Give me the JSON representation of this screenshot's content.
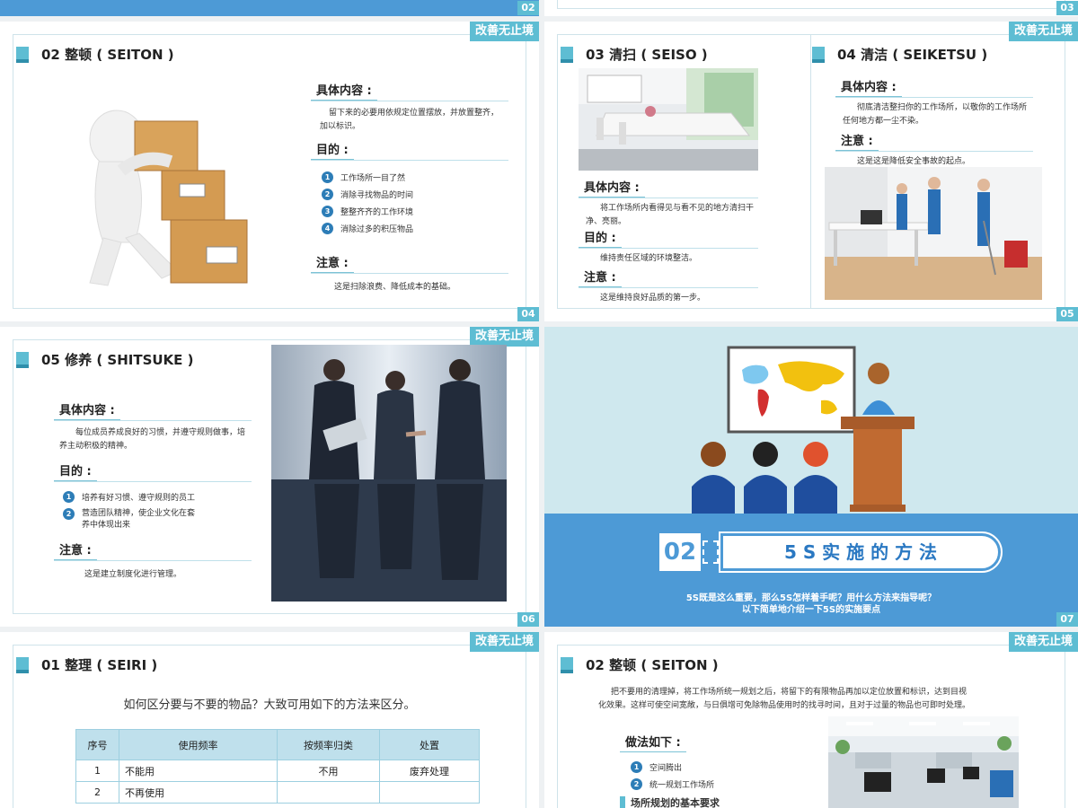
{
  "slides": {
    "s2_top": {
      "page": "02"
    },
    "s3_top": {
      "page": "03"
    },
    "s4": {
      "tag": "改善无止境",
      "page": "04",
      "title": "02  整顿 ( SEITON )",
      "content_header": "具体内容 :",
      "content_text": "留下来的必要用依规定位置摆放，并放置整齐，加以标识。",
      "purpose_header": "目的 :",
      "items": [
        "工作场所一目了然",
        "消除寻找物品的时间",
        "整整齐齐的工作环境",
        "消除过多的积压物品"
      ],
      "note_header": "注意 :",
      "note_text": "这是扫除浪费、降低成本的基础。"
    },
    "s5": {
      "tag": "改善无止境",
      "page": "05",
      "left_title": "03  清扫 ( SEISO )",
      "left_content_header": "具体内容 :",
      "left_content_text": "将工作场所内看得见与看不见的地方清扫干净、亮丽。",
      "left_purpose_header": "目的 :",
      "left_purpose_text": "维持责任区域的环境整洁。",
      "left_note_header": "注意 :",
      "left_note_text": "这是维持良好品质的第一步。",
      "right_title": "04  清洁 ( SEIKETSU )",
      "right_content_header": "具体内容 :",
      "right_content_text": "彻底清洁整扫你的工作场所，以敬你的工作场所任何地方都一尘不染。",
      "right_note_header": "注意 :",
      "right_note_text": "这是这是降低安全事故的起点。"
    },
    "s6": {
      "tag": "改善无止境",
      "page": "06",
      "title": "05  修养 ( SHITSUKE )",
      "content_header": "具体内容 :",
      "content_text": "每位成员养成良好的习惯，并遵守规则做事，培养主动积极的精神。",
      "purpose_header": "目的 :",
      "items": [
        "培养有好习惯、遵守规则的员工",
        "营造团队精神，使企业文化在套养中体现出来"
      ],
      "note_header": "注意 :",
      "note_text": "这是建立制度化进行管理。"
    },
    "s7": {
      "page": "07",
      "section_num": "02",
      "section_title": "5 S 实 施 的 方 法",
      "line1": "5S既是这么重要，那么5S怎样着手呢？用什么方法来指导呢？",
      "line2": "以下简单地介绍一下5S的实施要点"
    },
    "s8": {
      "tag": "改善无止境",
      "title": "01  整理 ( SEIRI )",
      "intro": "如何区分要与不要的物品？大致可用如下的方法来区分。",
      "table_headers": [
        "序号",
        "使用频率",
        "按频率归类",
        "处置"
      ],
      "rows": [
        [
          "1",
          "不能用",
          "不用",
          "废弃处理"
        ],
        [
          "2",
          "不再使用",
          "",
          ""
        ]
      ]
    },
    "s9": {
      "tag": "改善无止境",
      "title": "02  整顿 ( SEITON )",
      "para1": "把不要用的清理掉，将工作场所统一规划之后，将留下的有限物品再加以定位放置和标识，达到目视",
      "para2": "化效果。这样可使空间宽敞，与日俱增可免除物品使用时的找寻时间，且对于过量的物品也可即时处理。",
      "method_header": "做法如下 :",
      "items": [
        "空间腾出",
        "统一规划工作场所"
      ],
      "sub_header": "场所规划的基本要求"
    }
  },
  "colors": {
    "accent": "#5ebdd3",
    "accent_dark": "#2f8fab",
    "blue_band": "#4d9ad6",
    "number_badge": "#2d7db7",
    "teal_bg": "#cfe8ee"
  }
}
